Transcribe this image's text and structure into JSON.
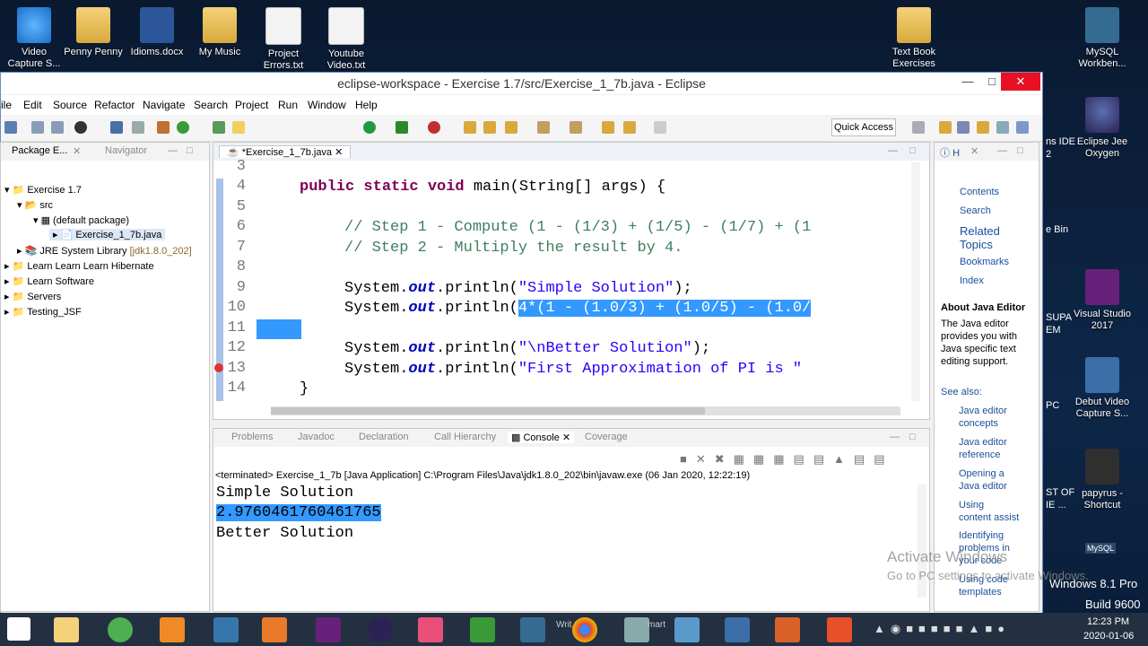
{
  "desktop": {
    "icons_top": [
      {
        "label": "Video\nCapture S...",
        "kind": "ie"
      },
      {
        "label": "Penny Penny",
        "kind": "folder"
      },
      {
        "label": "Idioms.docx",
        "kind": "word"
      },
      {
        "label": "My Music",
        "kind": "folder"
      },
      {
        "label": "Project\nErrors.txt",
        "kind": "doc"
      },
      {
        "label": "Youtube\nVideo.txt",
        "kind": "doc"
      },
      {
        "label": "Text Book\nExercises",
        "kind": "folder"
      },
      {
        "label": "MySQL\nWorkben...",
        "kind": "mysql"
      }
    ],
    "icons_right": [
      {
        "label": "Eclipse Jee\nOxygen",
        "kind": "eclipse"
      },
      {
        "label": "Visual Studio\n2017",
        "kind": "vs"
      },
      {
        "label": "Debut Video\nCapture S...",
        "kind": "film"
      },
      {
        "label": "papyrus -\nShortcut",
        "kind": "papy"
      }
    ],
    "partial_labels": [
      "ns IDE",
      "2",
      "e Bin",
      "SUPA",
      "EM",
      "PC",
      "ST OF",
      "IE ...",
      "MySQL"
    ],
    "watermark_line1": "Activate Windows",
    "watermark_line2": "Go to PC settings to activate Windows.",
    "corner_text1": "Windows 8.1 Pro",
    "corner_text2": "Build 9600"
  },
  "window": {
    "title": "eclipse-workspace - Exercise 1.7/src/Exercise_1_7b.java - Eclipse",
    "menus": [
      "ile",
      "Edit",
      "Source",
      "Refactor",
      "Navigate",
      "Search",
      "Project",
      "Run",
      "Window",
      "Help"
    ],
    "quick_access": "Quick Access"
  },
  "package_explorer": {
    "tab_label": "Package E...",
    "tab2_label": "Navigator",
    "tree": [
      {
        "label": "Exercise 1.7",
        "depth": 0
      },
      {
        "label": "src",
        "depth": 1
      },
      {
        "label": "(default package)",
        "depth": 2
      },
      {
        "label": "Exercise_1_7b.java",
        "depth": 3
      },
      {
        "label": "JRE System Library",
        "suffix": "[jdk1.8.0_202]",
        "depth": 1
      },
      {
        "label": "Learn Learn Learn Hibernate",
        "depth": 0
      },
      {
        "label": "Learn Software",
        "depth": 0
      },
      {
        "label": "Servers",
        "depth": 0
      },
      {
        "label": "Testing_JSF",
        "depth": 0
      }
    ]
  },
  "editor": {
    "tab_label": "*Exercise_1_7b.java",
    "line_numbers": [
      "3",
      "4",
      "5",
      "6",
      "7",
      "8",
      "9",
      "10",
      "11",
      "12",
      "13",
      "14"
    ],
    "lines": {
      "l4_kw": "public static void",
      "l4_rest": " main(String[] args) {",
      "l6": "// Step 1 - Compute (1 - (1/3) + (1/5) - (1/7) + (1",
      "l7": "// Step 2 - Multiply the result by 4.",
      "l9_a": "System.",
      "l9_out": "out",
      "l9_b": ".println(",
      "l9_str": "\"Simple Solution\"",
      "l9_end": ");",
      "l10_a": "System.",
      "l10_out": "out",
      "l10_b": ".println(",
      "l10_sel": "4*(1 - (1.0/3) + (1.0/5) - (1.0/",
      "l12_a": "System.",
      "l12_out": "out",
      "l12_b": ".println(",
      "l12_str": "\"\\nBetter Solution\"",
      "l12_end": ");",
      "l13_a": "System.",
      "l13_out": "out",
      "l13_b": ".println(",
      "l13_str": "\"First Approximation of PI is \"",
      "l14": "}"
    }
  },
  "bottom_panel": {
    "tabs": [
      "Problems",
      "Javadoc",
      "Declaration",
      "Call Hierarchy",
      "Console",
      "Coverage"
    ],
    "active_tab": "Console",
    "terminated": "<terminated> Exercise_1_7b [Java Application] C:\\Program Files\\Java\\jdk1.8.0_202\\bin\\javaw.exe (06 Jan 2020, 12:22:19)",
    "output": [
      "Simple Solution",
      "2.9760461760461765",
      "Better Solution"
    ]
  },
  "help_view": {
    "tab_label": "H",
    "links": [
      "Contents",
      "Search",
      "Related\nTopics",
      "Bookmarks",
      "Index"
    ],
    "heading": "About Java Editor",
    "body": "The Java editor provides you with Java specific text editing support.",
    "see_also": "See also:",
    "see_links": [
      "Java editor\nconcepts",
      "Java editor\nreference",
      "Opening a\nJava editor",
      "Using\ncontent assist",
      "Identifying\nproblems in\nyour code",
      "Using code\ntemplates"
    ]
  },
  "taskbar": {
    "time": "12:23 PM",
    "date": "2020-01-06",
    "partial": [
      "Writ",
      "mart"
    ]
  }
}
